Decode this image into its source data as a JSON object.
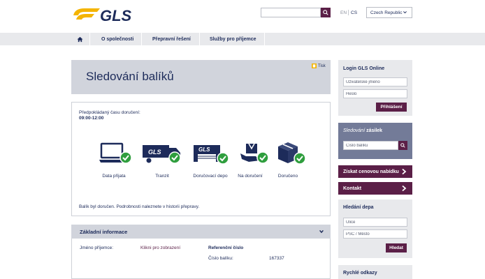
{
  "brand": {
    "logo_text": "GLS",
    "accent": "#f4b400",
    "navy": "#1d2b5a",
    "purple": "#5b1f47"
  },
  "header": {
    "search": {
      "placeholder": ""
    },
    "languages": [
      "EN",
      "CS"
    ],
    "active_language": "CS",
    "country": "Czech Republic"
  },
  "nav": {
    "home_icon": "home-icon",
    "items": [
      "O společnosti",
      "Přepravní řešení",
      "Služby pro příjemce"
    ]
  },
  "tracking": {
    "title": "Sledování balíků",
    "print_label": "Tisk",
    "eta_label": "Předpokládaný času doručení:",
    "eta_value": "09:00-12:00",
    "steps": [
      {
        "label": "Data přijata",
        "icon": "laptop-icon",
        "done": true
      },
      {
        "label": "Tranzit",
        "icon": "truck-icon",
        "done": true
      },
      {
        "label": "Doručovací depo",
        "icon": "depot-icon",
        "done": true
      },
      {
        "label": "Na doručení",
        "icon": "hand-package-icon",
        "done": true
      },
      {
        "label": "Doručeno",
        "icon": "package-icon",
        "done": true
      }
    ],
    "status_message": "Balík byl doručen. Podrobnosti naleznete v historii přepravy."
  },
  "basic_info": {
    "title": "Základní informace",
    "recipient_label": "Jméno příjemce:",
    "recipient_link": "Klikni pro zobrazení",
    "reference_label": "Referenční číslo",
    "parcel_label": "Číslo balíku:",
    "parcel_number": "167337"
  },
  "sidebar": {
    "login": {
      "title": "Login GLS Online",
      "username_placeholder": "Uživatelské jméno",
      "password_placeholder": "Heslo",
      "submit": "Přihlášení"
    },
    "track": {
      "title_italic": "Sledování",
      "title_bold": "zásilek",
      "input_placeholder": "Číslo balíku"
    },
    "quote_link": "Získat cenovou nabídku",
    "contact_link": "Kontakt",
    "depot": {
      "title": "Hledání depa",
      "street_placeholder": "Ulice",
      "city_placeholder": "PSČ / Město",
      "submit": "Hledat"
    },
    "quick_links_title": "Rychlé odkazy"
  }
}
